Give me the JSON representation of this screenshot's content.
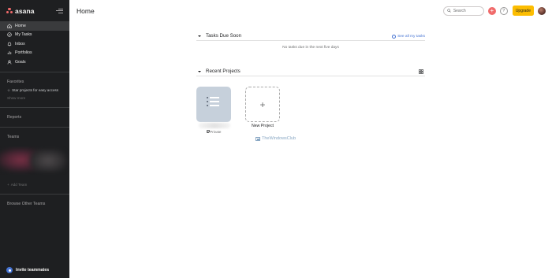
{
  "app": {
    "logo_text": "asana"
  },
  "sidebar": {
    "nav": [
      {
        "label": "Home",
        "icon": "home-icon",
        "active": true
      },
      {
        "label": "My Tasks",
        "icon": "check-circle-icon",
        "active": false
      },
      {
        "label": "Inbox",
        "icon": "bell-icon",
        "active": false
      },
      {
        "label": "Portfolios",
        "icon": "bar-chart-icon",
        "active": false
      },
      {
        "label": "Goals",
        "icon": "person-icon",
        "active": false
      }
    ],
    "favorites": {
      "heading": "Favorites",
      "star_hint": "Star projects for easy access",
      "show_more": "Show more"
    },
    "reports": "Reports",
    "teams": {
      "heading": "Teams",
      "add_team": "Add Team"
    },
    "browse_teams": "Browse Other Teams",
    "invite": "Invite teammates"
  },
  "header": {
    "title": "Home",
    "search_placeholder": "Search",
    "help": "?",
    "upgrade": "Upgrade"
  },
  "tasks_due": {
    "title": "Tasks Due Soon",
    "see_all": "See all my tasks",
    "empty": "No tasks due in the next five days"
  },
  "recent_projects": {
    "title": "Recent Projects",
    "project_visibility": "Private",
    "new_project": "New Project"
  },
  "watermark": "TheWindowsClub",
  "colors": {
    "sidebar_bg": "#1e1f21",
    "accent_coral": "#f06a6a",
    "upgrade_yellow": "#fcbd01",
    "link_blue": "#4573d2",
    "project_tile": "#c6d0db"
  }
}
